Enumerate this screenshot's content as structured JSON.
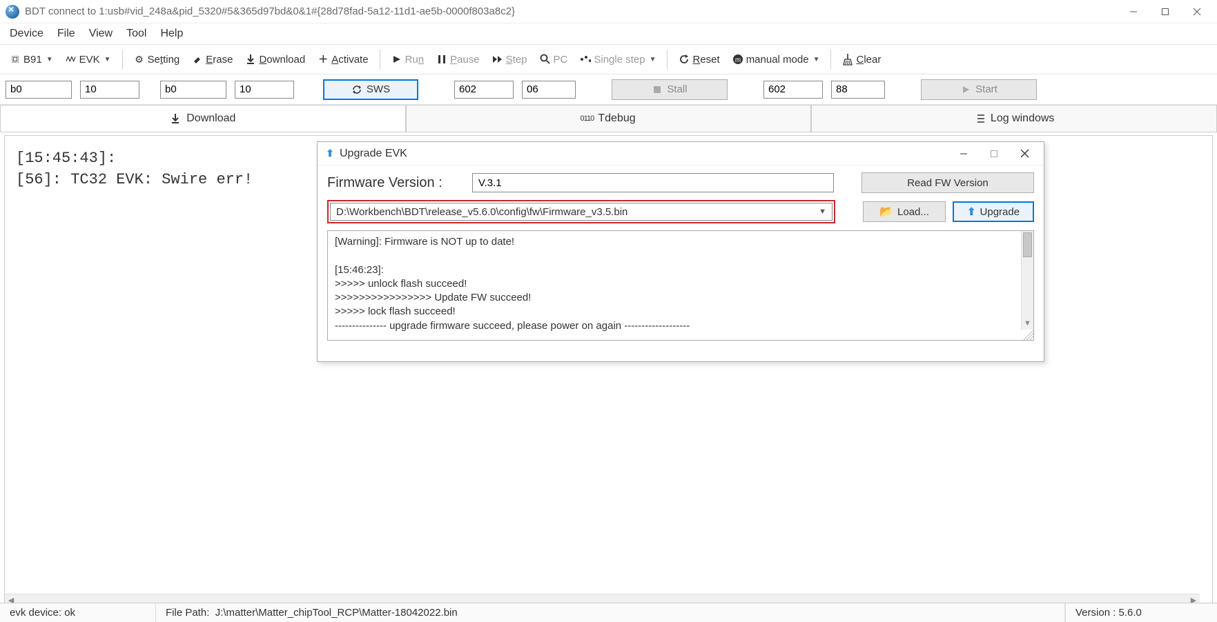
{
  "window": {
    "title": "BDT connect to 1:usb#vid_248a&pid_5320#5&365d97bd&0&1#{28d78fad-5a12-11d1-ae5b-0000f803a8c2}"
  },
  "menu": {
    "device": "Device",
    "file": "File",
    "view": "View",
    "tool": "Tool",
    "help": "Help"
  },
  "toolbar": {
    "chip": "B91",
    "evk": "EVK",
    "setting": "Setting",
    "erase": "Erase",
    "download": "Download",
    "activate": "Activate",
    "run": "Run",
    "pause": "Pause",
    "step": "Step",
    "pc": "PC",
    "single_step": "Single step",
    "reset": "Reset",
    "manual_mode": "manual mode",
    "clear": "Clear"
  },
  "inputs": {
    "a": "b0",
    "b": "10",
    "c": "b0",
    "d": "10",
    "sws": "SWS",
    "e": "602",
    "f": "06",
    "stall": "Stall",
    "g": "602",
    "h": "88",
    "start": "Start"
  },
  "tabs": {
    "download": "Download",
    "tdebug": "Tdebug",
    "log": "Log windows"
  },
  "log": "[15:45:43]:\n[56]: TC32 EVK: Swire err!",
  "dialog": {
    "title": "Upgrade EVK",
    "fw_label": "Firmware Version  :",
    "fw_value": "V.3.1",
    "read_fw": "Read FW Version",
    "path": "D:\\Workbench\\BDT\\release_v5.6.0\\config\\fw\\Firmware_v3.5.bin",
    "load": "Load...",
    "upgrade": "Upgrade",
    "log": "[Warning]: Firmware is NOT up to date!\n\n[15:46:23]:\n>>>>> unlock flash succeed!\n>>>>>>>>>>>>>>>> Update FW succeed!\n>>>>> lock flash succeed!\n--------------- upgrade firmware succeed, please power on again -------------------"
  },
  "status": {
    "device": "evk device: ok",
    "path_label": "File Path:",
    "path": "J:\\matter\\Matter_chipTool_RCP\\Matter-18042022.bin",
    "version": "Version : 5.6.0"
  }
}
